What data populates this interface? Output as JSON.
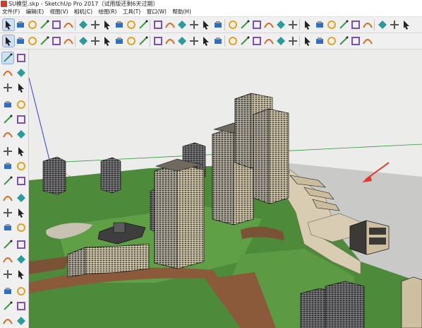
{
  "window": {
    "title": "SU模型.skp - SketchUp Pro 2017（试用版还剩6天过期）"
  },
  "menu": {
    "items": [
      "文件(F)",
      "编辑(E)",
      "视图(V)",
      "相机(C)",
      "绘图(R)",
      "工具(T)",
      "窗口(W)",
      "帮助(H)"
    ]
  },
  "toolbar_top": {
    "icons": [
      "select-icon",
      "eraser-icon",
      "pencil-icon",
      "freehand-icon",
      "rectangle-icon",
      "rotated-rectangle-icon",
      "circle-icon",
      "polygon-icon",
      "arc-icon",
      "pie-icon",
      "push-pull-icon",
      "move-icon",
      "rotate-icon",
      "scale-icon",
      "follow-me-icon",
      "offset-icon",
      "tape-measure-icon",
      "text-icon",
      "axes-icon",
      "dimension-icon",
      "protractor-icon",
      "3d-text-icon",
      "paint-bucket-icon",
      "orbit-icon",
      "pan-icon",
      "zoom-icon",
      "zoom-window-icon",
      "zoom-extents-icon",
      "previous-view-icon",
      "walk-icon",
      "look-around-icon",
      "position-camera-icon",
      "section-plane-icon",
      "warehouse-icon",
      "extension-icon"
    ]
  },
  "toolbar_second": {
    "icons": [
      "select-icon",
      "component-icon",
      "eraser-icon",
      "paint-icon",
      "line-icon",
      "arc-icon",
      "rectangle-icon",
      "push-pull-icon",
      "move-icon",
      "rotate-icon",
      "scale-icon",
      "offset-icon",
      "tape-icon",
      "text-icon",
      "orbit-icon",
      "pan-icon",
      "zoom-icon",
      "extents-icon",
      "iso-view-icon",
      "top-view-icon",
      "front-view-icon",
      "right-view-icon",
      "back-view-icon",
      "left-view-icon",
      "xray-icon",
      "wireframe-icon",
      "hidden-line-icon",
      "shaded-icon",
      "textured-icon",
      "monochrome-icon"
    ]
  },
  "left_toolbar": {
    "icons": [
      "select-icon",
      "component-icon",
      "paint-bucket-icon",
      "eraser-icon",
      "line-icon",
      "freehand-icon",
      "rectangle-icon",
      "rotated-rect-icon",
      "circle-icon",
      "polygon-icon",
      "arc-icon",
      "two-point-arc-icon",
      "pie-icon",
      "three-point-arc-icon",
      "move-icon",
      "push-pull-icon",
      "rotate-icon",
      "follow-me-icon",
      "scale-icon",
      "offset-icon",
      "tape-measure-icon",
      "dimension-icon",
      "protractor-icon",
      "text-icon",
      "axes-icon",
      "3d-text-icon",
      "orbit-icon",
      "pan-icon",
      "zoom-icon",
      "zoom-window-icon",
      "zoom-extents-icon",
      "previous-icon",
      "position-camera-icon",
      "look-around-icon",
      "walk-icon",
      "section-plane-icon"
    ]
  },
  "colors": {
    "grass": "#4d8a3a",
    "grass_light": "#5fa046",
    "road": "#8a5a3a",
    "sky": "#ececea",
    "annotation_arrow": "#e8342a"
  }
}
